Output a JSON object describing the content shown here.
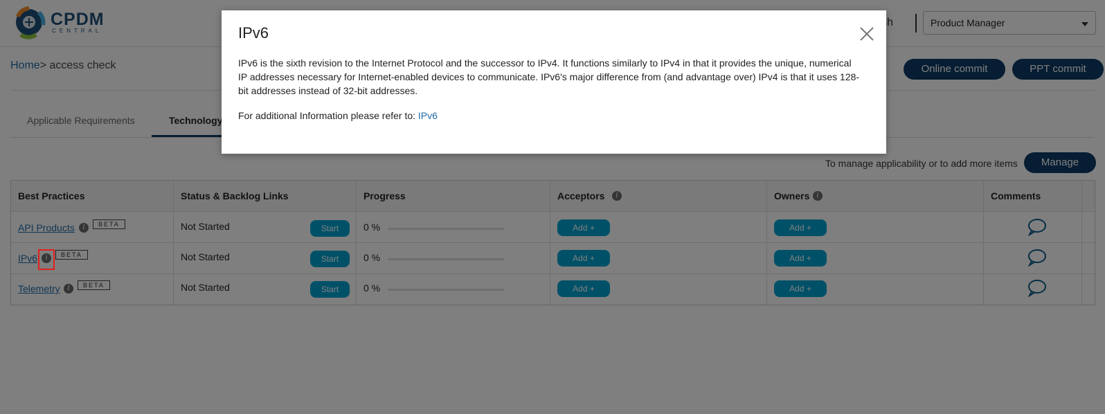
{
  "header": {
    "logo_text": "CPDM",
    "logo_sub": "CENTRAL",
    "user_name": "uresh",
    "role": "Product Manager"
  },
  "breadcrumb": {
    "home": "Home",
    "separator": ">",
    "current": " access check"
  },
  "actions": {
    "online_commit": "Online commit",
    "ppt_commit": "PPT commit"
  },
  "tabs": [
    {
      "label": "Applicable Requirements",
      "active": false
    },
    {
      "label": "Technology",
      "active": true
    }
  ],
  "manage": {
    "text": "To manage applicability or to add more items",
    "button": "Manage"
  },
  "table": {
    "headers": [
      "Best Practices",
      "Status & Backlog Links",
      "Progress",
      "Acceptors",
      "Owners",
      "Comments"
    ],
    "rows": [
      {
        "name": "API Products",
        "badge": "BETA",
        "status": "Not Started",
        "start": "Start",
        "progress": "0 %",
        "progress_value": 0,
        "acceptors_btn": "Add",
        "owners_btn": "Add"
      },
      {
        "name": "IPv6",
        "badge": "BETA",
        "status": "Not Started",
        "start": "Start",
        "progress": "0 %",
        "progress_value": 0,
        "acceptors_btn": "Add",
        "owners_btn": "Add"
      },
      {
        "name": "Telemetry",
        "badge": "BETA",
        "status": "Not Started",
        "start": "Start",
        "progress": "0 %",
        "progress_value": 0,
        "acceptors_btn": "Add",
        "owners_btn": "Add"
      }
    ]
  },
  "icons": {
    "info": "info-icon",
    "comment": "comment-icon",
    "plus": "plus-icon",
    "close": "close-icon",
    "caret": "chevron-down-icon"
  },
  "colors": {
    "primary_dark": "#0d3b66",
    "accent_cyan": "#00a3d1",
    "link": "#1f6aa5",
    "highlight": "#e0201c"
  },
  "modal": {
    "title": "IPv6",
    "body": "IPv6 is the sixth revision to the Internet Protocol and the successor to IPv4. It functions similarly to IPv4 in that it provides the unique, numerical IP addresses necessary for Internet-enabled devices to communicate. IPv6's major difference from (and advantage over) IPv4 is that it uses 128-bit addresses instead of 32-bit addresses.",
    "ref_prefix": "For additional Information please refer to: ",
    "ref_link": "IPv6"
  }
}
